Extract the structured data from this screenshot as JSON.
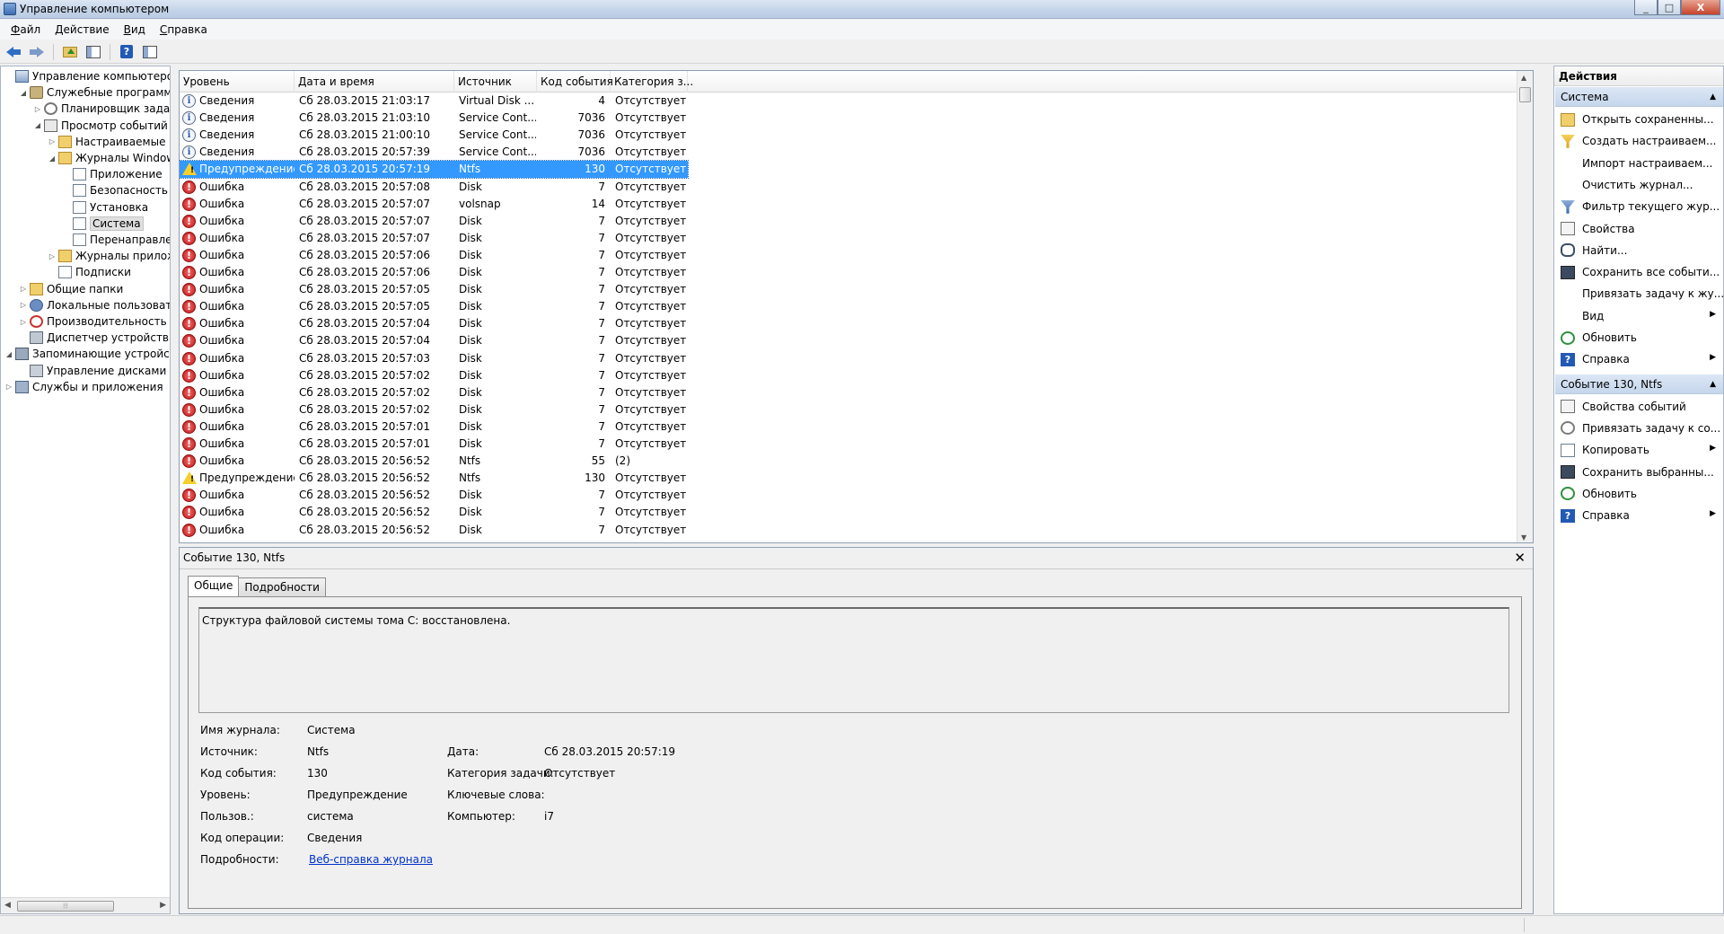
{
  "window": {
    "title": "Управление компьютером",
    "controls": [
      "_",
      "□",
      "X"
    ]
  },
  "menu": [
    "Файл",
    "Действие",
    "Вид",
    "Справка"
  ],
  "toolbar": {
    "icons": [
      "back-arrow-icon",
      "forward-arrow-icon",
      "folder-up-icon",
      "show-hide-tree-icon",
      "help-icon",
      "show-hide-action-pane-icon"
    ]
  },
  "tree": [
    {
      "label": "Управление компьютером (л",
      "icon": "computer-icon",
      "expander": "",
      "expanded": true
    },
    {
      "label": "Служебные программы",
      "icon": "tools-icon",
      "expander": "◢",
      "expanded": true
    },
    {
      "label": "Планировщик заданий",
      "icon": "clock-icon",
      "expander": "▷",
      "expanded": false
    },
    {
      "label": "Просмотр событий",
      "icon": "event-viewer-icon",
      "expander": "◢",
      "expanded": true
    },
    {
      "label": "Настраиваемые пр",
      "icon": "folder-icon",
      "expander": "▷",
      "expanded": false
    },
    {
      "label": "Журналы Windows",
      "icon": "folder-icon",
      "expander": "◢",
      "expanded": true
    },
    {
      "label": "Приложение",
      "icon": "log-icon",
      "expander": "",
      "expanded": false
    },
    {
      "label": "Безопасность",
      "icon": "log-icon",
      "expander": "",
      "expanded": false
    },
    {
      "label": "Установка",
      "icon": "log-icon",
      "expander": "",
      "expanded": false
    },
    {
      "label": "Система",
      "icon": "log-icon",
      "expander": "",
      "expanded": false,
      "selected": true
    },
    {
      "label": "Перенаправлен",
      "icon": "log-icon",
      "expander": "",
      "expanded": false
    },
    {
      "label": "Журналы приложе",
      "icon": "folder-icon",
      "expander": "▷",
      "expanded": false
    },
    {
      "label": "Подписки",
      "icon": "log-icon",
      "expander": "",
      "expanded": false
    },
    {
      "label": "Общие папки",
      "icon": "shared-folder-icon",
      "expander": "▷",
      "expanded": false
    },
    {
      "label": "Локальные пользовате",
      "icon": "users-icon",
      "expander": "▷",
      "expanded": false
    },
    {
      "label": "Производительность",
      "icon": "performance-icon",
      "expander": "▷",
      "expanded": false
    },
    {
      "label": "Диспетчер устройств",
      "icon": "device-manager-icon",
      "expander": "",
      "expanded": false
    },
    {
      "label": "Запоминающие устройст",
      "icon": "storage-icon",
      "expander": "◢",
      "expanded": true
    },
    {
      "label": "Управление дисками",
      "icon": "disk-icon",
      "expander": "",
      "expanded": false
    },
    {
      "label": "Службы и приложения",
      "icon": "services-icon",
      "expander": "▷",
      "expanded": false
    }
  ],
  "events": {
    "columns": [
      "Уровень",
      "Дата и время",
      "Источник",
      "Код события",
      "Категория з..."
    ],
    "selected_index": 4,
    "rows": [
      {
        "level": "Сведения",
        "type": "info",
        "date": "Сб 28.03.2015 21:03:17",
        "source": "Virtual Disk ...",
        "id": "4",
        "category": "Отсутствует"
      },
      {
        "level": "Сведения",
        "type": "info",
        "date": "Сб 28.03.2015 21:03:10",
        "source": "Service Cont...",
        "id": "7036",
        "category": "Отсутствует"
      },
      {
        "level": "Сведения",
        "type": "info",
        "date": "Сб 28.03.2015 21:00:10",
        "source": "Service Cont...",
        "id": "7036",
        "category": "Отсутствует"
      },
      {
        "level": "Сведения",
        "type": "info",
        "date": "Сб 28.03.2015 20:57:39",
        "source": "Service Cont...",
        "id": "7036",
        "category": "Отсутствует"
      },
      {
        "level": "Предупреждение",
        "type": "warn",
        "date": "Сб 28.03.2015 20:57:19",
        "source": "Ntfs",
        "id": "130",
        "category": "Отсутствует"
      },
      {
        "level": "Ошибка",
        "type": "error",
        "date": "Сб 28.03.2015 20:57:08",
        "source": "Disk",
        "id": "7",
        "category": "Отсутствует"
      },
      {
        "level": "Ошибка",
        "type": "error",
        "date": "Сб 28.03.2015 20:57:07",
        "source": "volsnap",
        "id": "14",
        "category": "Отсутствует"
      },
      {
        "level": "Ошибка",
        "type": "error",
        "date": "Сб 28.03.2015 20:57:07",
        "source": "Disk",
        "id": "7",
        "category": "Отсутствует"
      },
      {
        "level": "Ошибка",
        "type": "error",
        "date": "Сб 28.03.2015 20:57:07",
        "source": "Disk",
        "id": "7",
        "category": "Отсутствует"
      },
      {
        "level": "Ошибка",
        "type": "error",
        "date": "Сб 28.03.2015 20:57:06",
        "source": "Disk",
        "id": "7",
        "category": "Отсутствует"
      },
      {
        "level": "Ошибка",
        "type": "error",
        "date": "Сб 28.03.2015 20:57:06",
        "source": "Disk",
        "id": "7",
        "category": "Отсутствует"
      },
      {
        "level": "Ошибка",
        "type": "error",
        "date": "Сб 28.03.2015 20:57:05",
        "source": "Disk",
        "id": "7",
        "category": "Отсутствует"
      },
      {
        "level": "Ошибка",
        "type": "error",
        "date": "Сб 28.03.2015 20:57:05",
        "source": "Disk",
        "id": "7",
        "category": "Отсутствует"
      },
      {
        "level": "Ошибка",
        "type": "error",
        "date": "Сб 28.03.2015 20:57:04",
        "source": "Disk",
        "id": "7",
        "category": "Отсутствует"
      },
      {
        "level": "Ошибка",
        "type": "error",
        "date": "Сб 28.03.2015 20:57:04",
        "source": "Disk",
        "id": "7",
        "category": "Отсутствует"
      },
      {
        "level": "Ошибка",
        "type": "error",
        "date": "Сб 28.03.2015 20:57:03",
        "source": "Disk",
        "id": "7",
        "category": "Отсутствует"
      },
      {
        "level": "Ошибка",
        "type": "error",
        "date": "Сб 28.03.2015 20:57:02",
        "source": "Disk",
        "id": "7",
        "category": "Отсутствует"
      },
      {
        "level": "Ошибка",
        "type": "error",
        "date": "Сб 28.03.2015 20:57:02",
        "source": "Disk",
        "id": "7",
        "category": "Отсутствует"
      },
      {
        "level": "Ошибка",
        "type": "error",
        "date": "Сб 28.03.2015 20:57:02",
        "source": "Disk",
        "id": "7",
        "category": "Отсутствует"
      },
      {
        "level": "Ошибка",
        "type": "error",
        "date": "Сб 28.03.2015 20:57:01",
        "source": "Disk",
        "id": "7",
        "category": "Отсутствует"
      },
      {
        "level": "Ошибка",
        "type": "error",
        "date": "Сб 28.03.2015 20:57:01",
        "source": "Disk",
        "id": "7",
        "category": "Отсутствует"
      },
      {
        "level": "Ошибка",
        "type": "error",
        "date": "Сб 28.03.2015 20:56:52",
        "source": "Ntfs",
        "id": "55",
        "category": "(2)"
      },
      {
        "level": "Предупреждение",
        "type": "warn",
        "date": "Сб 28.03.2015 20:56:52",
        "source": "Ntfs",
        "id": "130",
        "category": "Отсутствует"
      },
      {
        "level": "Ошибка",
        "type": "error",
        "date": "Сб 28.03.2015 20:56:52",
        "source": "Disk",
        "id": "7",
        "category": "Отсутствует"
      },
      {
        "level": "Ошибка",
        "type": "error",
        "date": "Сб 28.03.2015 20:56:52",
        "source": "Disk",
        "id": "7",
        "category": "Отсутствует"
      },
      {
        "level": "Ошибка",
        "type": "error",
        "date": "Сб 28.03.2015 20:56:52",
        "source": "Disk",
        "id": "7",
        "category": "Отсутствует"
      }
    ]
  },
  "details": {
    "title": "Событие 130, Ntfs",
    "close": "✕",
    "tabs": [
      "Общие",
      "Подробности"
    ],
    "message": "Структура файловой системы тома C: восстановлена.",
    "labels": {
      "log_name": "Имя журнала:",
      "source": "Источник:",
      "event_id": "Код события:",
      "level": "Уровень:",
      "user": "Пользов.:",
      "opcode": "Код операции:",
      "more_info": "Подробности:",
      "date": "Дата:",
      "task_category": "Категория задачи:",
      "keywords": "Ключевые слова:",
      "computer": "Компьютер:"
    },
    "values": {
      "log_name": "Система",
      "source": "Ntfs",
      "event_id": "130",
      "level": "Предупреждение",
      "user": "система",
      "opcode": "Сведения",
      "more_info": "Веб-справка журнала",
      "date": "Сб 28.03.2015 20:57:19",
      "task_category": "Отсутствует",
      "keywords": "",
      "computer": "i7"
    }
  },
  "actions": {
    "title": "Действия",
    "sections": [
      {
        "title": "Система",
        "items": [
          {
            "label": "Открыть сохраненны...",
            "icon": "open-folder-icon",
            "submenu": false
          },
          {
            "label": "Создать настраиваем...",
            "icon": "create-filter-icon",
            "submenu": false
          },
          {
            "label": "Импорт настраиваем...",
            "icon": "",
            "submenu": false
          },
          {
            "label": "Очистить журнал...",
            "icon": "",
            "submenu": false
          },
          {
            "label": "Фильтр текущего жур...",
            "icon": "filter-icon",
            "submenu": false
          },
          {
            "label": "Свойства",
            "icon": "properties-icon",
            "submenu": false
          },
          {
            "label": "Найти...",
            "icon": "find-icon",
            "submenu": false
          },
          {
            "label": "Сохранить все событи...",
            "icon": "save-icon",
            "submenu": false
          },
          {
            "label": "Привязать задачу к жу...",
            "icon": "",
            "submenu": false
          },
          {
            "label": "Вид",
            "icon": "",
            "submenu": true
          },
          {
            "label": "Обновить",
            "icon": "refresh-icon",
            "submenu": false
          },
          {
            "label": "Справка",
            "icon": "help-icon",
            "submenu": true
          }
        ]
      },
      {
        "title": "Событие 130, Ntfs",
        "items": [
          {
            "label": "Свойства событий",
            "icon": "properties-icon",
            "submenu": false
          },
          {
            "label": "Привязать задачу к со...",
            "icon": "task-icon",
            "submenu": false
          },
          {
            "label": "Копировать",
            "icon": "copy-icon",
            "submenu": true
          },
          {
            "label": "Сохранить выбранны...",
            "icon": "save-icon",
            "submenu": false
          },
          {
            "label": "Обновить",
            "icon": "refresh-icon",
            "submenu": false
          },
          {
            "label": "Справка",
            "icon": "help-icon",
            "submenu": true
          }
        ]
      }
    ]
  }
}
